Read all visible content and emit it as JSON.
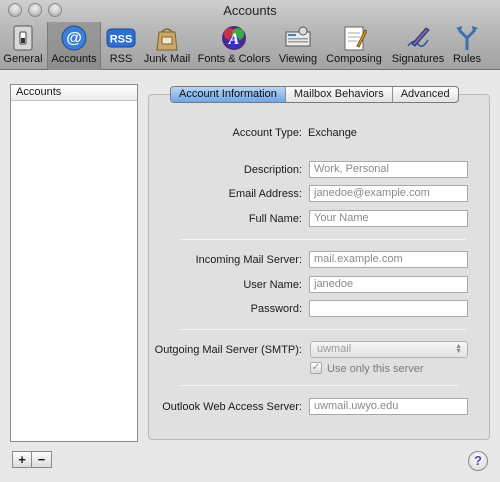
{
  "window": {
    "title": "Accounts"
  },
  "toolbar": {
    "items": [
      {
        "label": "General",
        "icon": "switch-icon"
      },
      {
        "label": "Accounts",
        "icon": "at-sign-icon",
        "selected": true
      },
      {
        "label": "RSS",
        "icon": "rss-icon"
      },
      {
        "label": "Junk Mail",
        "icon": "junk-bag-icon"
      },
      {
        "label": "Fonts & Colors",
        "icon": "font-color-icon"
      },
      {
        "label": "Viewing",
        "icon": "viewing-icon"
      },
      {
        "label": "Composing",
        "icon": "composing-icon"
      },
      {
        "label": "Signatures",
        "icon": "signature-pen-icon"
      },
      {
        "label": "Rules",
        "icon": "rules-icon"
      }
    ],
    "rss_badge": "RSS"
  },
  "sidebar": {
    "header": "Accounts",
    "add_label": "+",
    "remove_label": "−"
  },
  "tabs": [
    {
      "label": "Account Information",
      "active": true
    },
    {
      "label": "Mailbox Behaviors",
      "active": false
    },
    {
      "label": "Advanced",
      "active": false
    }
  ],
  "form": {
    "account_type_label": "Account Type:",
    "account_type_value": "Exchange",
    "description_label": "Description:",
    "description_placeholder": "Work, Personal",
    "email_label": "Email Address:",
    "email_placeholder": "janedoe@example.com",
    "fullname_label": "Full Name:",
    "fullname_placeholder": "Your Name",
    "incoming_label": "Incoming Mail Server:",
    "incoming_placeholder": "mail.example.com",
    "username_label": "User Name:",
    "username_placeholder": "janedoe",
    "password_label": "Password:",
    "password_value": "",
    "outgoing_label": "Outgoing Mail Server (SMTP):",
    "outgoing_value": "uwmail",
    "use_only_label": "Use only this server",
    "use_only_checked": true,
    "owa_label": "Outlook Web Access Server:",
    "owa_value": "uwmail.uwyo.edu"
  },
  "help_label": "?",
  "colors": {
    "accent": "#6fa6e8",
    "toolbar": "#b9b9b9"
  }
}
